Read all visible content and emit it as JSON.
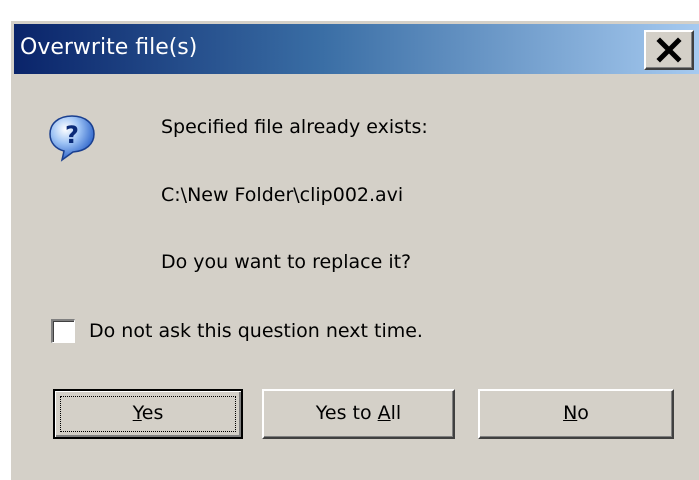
{
  "window": {
    "title": "Overwrite file(s)"
  },
  "icons": {
    "question": "question-icon",
    "close": "close-icon"
  },
  "message": {
    "line1": "Specified file already exists:",
    "path": "C:\\New Folder\\clip002.avi",
    "question": "Do you want to replace it?"
  },
  "checkbox": {
    "label": "Do not ask this question next time.",
    "checked": false
  },
  "buttons": {
    "yes": {
      "pre": "",
      "mnemonic": "Y",
      "post": "es"
    },
    "yes_to_all": {
      "pre": "Yes to ",
      "mnemonic": "A",
      "post": "ll"
    },
    "no": {
      "pre": "",
      "mnemonic": "N",
      "post": "o"
    }
  },
  "colors": {
    "title_gradient_start": "#0a246a",
    "title_gradient_end": "#a6caf0",
    "dialog_face": "#d4d0c8"
  }
}
